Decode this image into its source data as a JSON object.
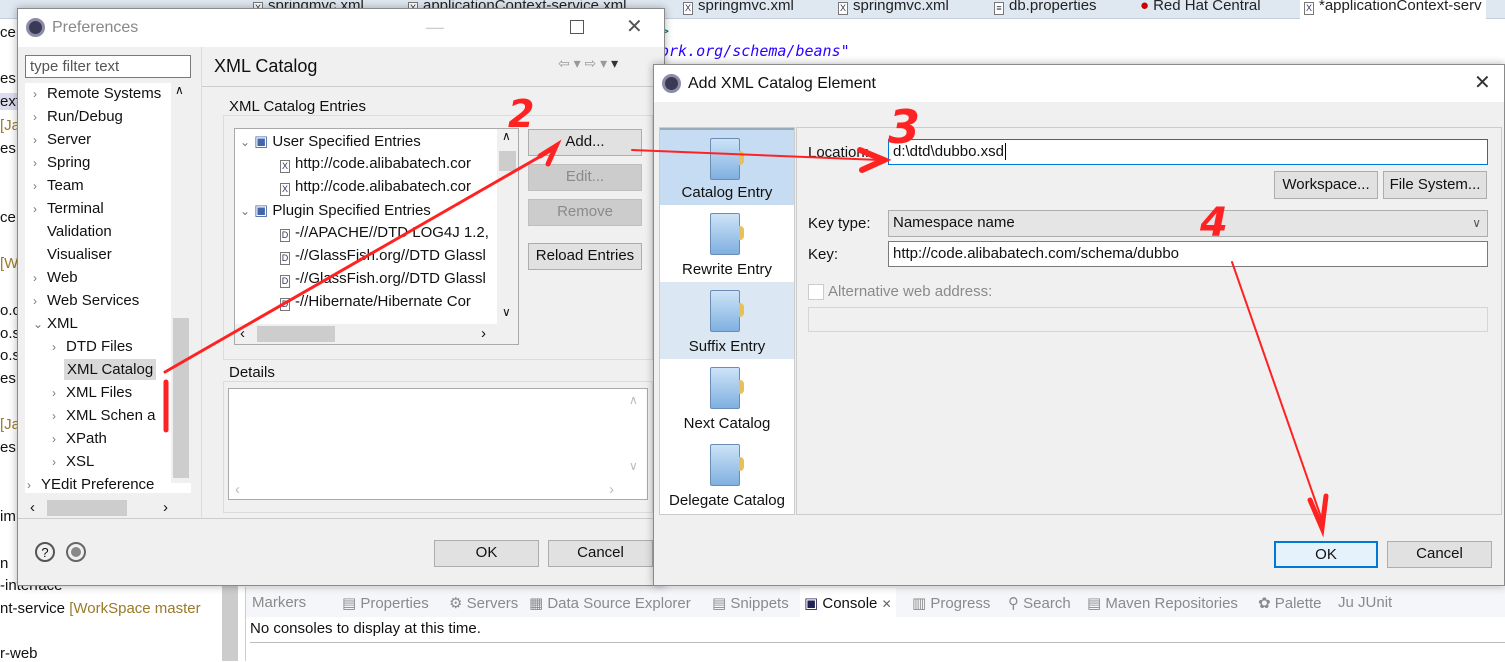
{
  "editor_tabs": [
    "springmvc.xml",
    "applicationContext-service.xml",
    "springmvc.xml",
    "springmvc.xml",
    "db.properties",
    "Red Hat Central",
    "*applicationContext-serv"
  ],
  "editor_lines": [
    ">",
    "ork.org/schema/beans\""
  ],
  "explorer_fragments": [
    "ce",
    "es",
    "ext",
    "[Ja",
    "es",
    "ce",
    "[W",
    "o.c",
    "o.s",
    "o.s",
    "es",
    "[Ja",
    "es",
    "im",
    "n",
    "-interface",
    "nt-service",
    "[WorkSpace master",
    "r-web"
  ],
  "preferences": {
    "title": "Preferences",
    "filter_placeholder": "type filter text",
    "tree": [
      "Remote Systems",
      "Run/Debug",
      "Server",
      "Spring",
      "Team",
      "Terminal",
      "Validation",
      "Visualiser",
      "Web",
      "Web Services",
      "XML",
      "DTD Files",
      "XML Catalog",
      "XML Files",
      "XML Schen a",
      "XPath",
      "XSL",
      "YEdit Preference"
    ],
    "page_title": "XML Catalog",
    "entries_group": "XML Catalog Entries",
    "entries": [
      "User Specified Entries",
      "http://code.alibabatech.cor",
      "http://code.alibabatech.cor",
      "Plugin Specified Entries",
      "-//APACHE//DTD LOG4J 1.2,",
      "-//GlassFish.org//DTD Glassl",
      "-//GlassFish.org//DTD Glassl",
      "-//Hibernate/Hibernate Cor"
    ],
    "buttons": {
      "add": "Add...",
      "edit": "Edit...",
      "remove": "Remove",
      "reload": "Reload Entries",
      "ok": "OK",
      "cancel": "Cancel"
    },
    "details_group": "Details"
  },
  "add_dialog": {
    "title": "Add XML Catalog Element",
    "categories": [
      "Catalog Entry",
      "Rewrite Entry",
      "Suffix Entry",
      "Next Catalog",
      "Delegate Catalog"
    ],
    "selected_category": "Catalog Entry",
    "location_label": "Location:",
    "location_value": "d:\\dtd\\dubbo.xsd",
    "workspace_button": "Workspace...",
    "filesystem_button": "File System...",
    "key_type_label": "Key type:",
    "key_type_value": "Namespace name",
    "key_label": "Key:",
    "key_value": "http://code.alibabatech.com/schema/dubbo",
    "alt_web_label": "Alternative web address:",
    "alt_web_checked": false,
    "ok": "OK",
    "cancel": "Cancel"
  },
  "bottom_panel": {
    "tabs": [
      "Markers",
      "Properties",
      "Servers",
      "Data Source Explorer",
      "Snippets",
      "Console",
      "Progress",
      "Search",
      "Maven Repositories",
      "Palette",
      "JUnit"
    ],
    "active_tab": "Console",
    "message": "No consoles to display at this time."
  },
  "annotations": {
    "color": "#ff2222",
    "steps": [
      "1",
      "2",
      "3",
      "4"
    ]
  }
}
